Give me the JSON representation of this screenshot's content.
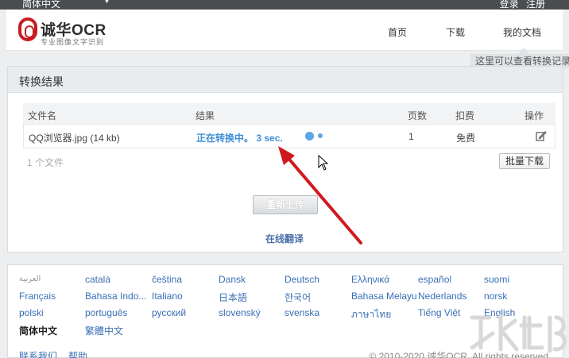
{
  "topbar": {
    "language": "简体中文",
    "login": "登录",
    "register": "注册"
  },
  "header": {
    "logo_name": "诚华OCR",
    "logo_sub": "专业图像文字识别",
    "nav": [
      "首页",
      "下载",
      "我的文档"
    ]
  },
  "tooltip": "这里可以查看转换记录",
  "panel": {
    "title": "转换结果",
    "columns": [
      "文件名",
      "结果",
      "页数",
      "扣费",
      "操作"
    ],
    "row": {
      "file": "QQ浏览器.jpg (14 kb)",
      "status": "正在转换中。 3 sec.",
      "pages": "1",
      "fee": "免费"
    },
    "file_count": "1 个文件",
    "batch_download": "批量下载",
    "reupload": "重新上传",
    "online_translate": "在线翻译"
  },
  "footer": {
    "languages": [
      "العربية",
      "català",
      "čeština",
      "Dansk",
      "Deutsch",
      "Ελληνικά",
      "español",
      "suomi",
      "Français",
      "Bahasa Indo...",
      "Italiano",
      "日本語",
      "한국어",
      "Bahasa Melayu",
      "Nederlands",
      "norsk",
      "polski",
      "português",
      "русский",
      "slovenský",
      "svenska",
      "ภาษาไทย",
      "Tiếng Việt",
      "English",
      "简体中文",
      "繁體中文"
    ],
    "current_language": "简体中文",
    "contact": "联系我们",
    "help": "帮助",
    "copyright": "© 2010-2020 诚华OCR. All rights reserved"
  },
  "colors": {
    "accent_blue": "#3d8fd6",
    "link_blue": "#3a6fb5",
    "logo_red": "#c61d23",
    "arrow_red": "#d0191f"
  }
}
